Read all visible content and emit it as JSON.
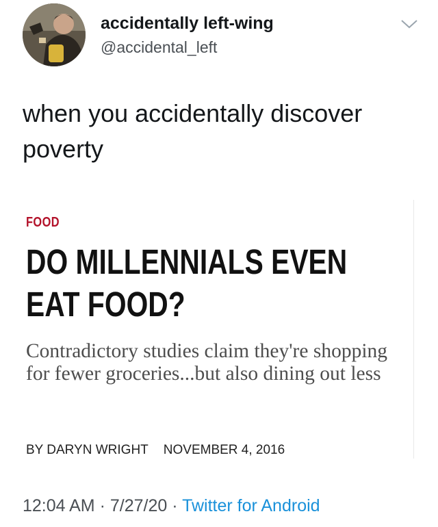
{
  "author": {
    "display_name": "accidentally left-wing",
    "handle": "@accidental_left",
    "avatar_icon": "avatar-photo-icon"
  },
  "menu_icon": "chevron-down-icon",
  "tweet": {
    "text_line1": "when you accidentally discover",
    "text_line2": "poverty"
  },
  "article": {
    "category": "FOOD",
    "headline_line1": "DO MILLENNIALS EVEN",
    "headline_line2": "EAT FOOD?",
    "subhead": "Contradictory studies claim they're shopping for fewer groceries...but also dining out less",
    "byline": "BY DARYN WRIGHT",
    "date": "NOVEMBER 4, 2016"
  },
  "meta": {
    "time": "12:04 AM",
    "date": "7/27/20",
    "separator": "·",
    "source": "Twitter for Android"
  },
  "colors": {
    "link": "#1a91da",
    "category": "#b3122a",
    "secondary_text": "#4a4f54"
  }
}
